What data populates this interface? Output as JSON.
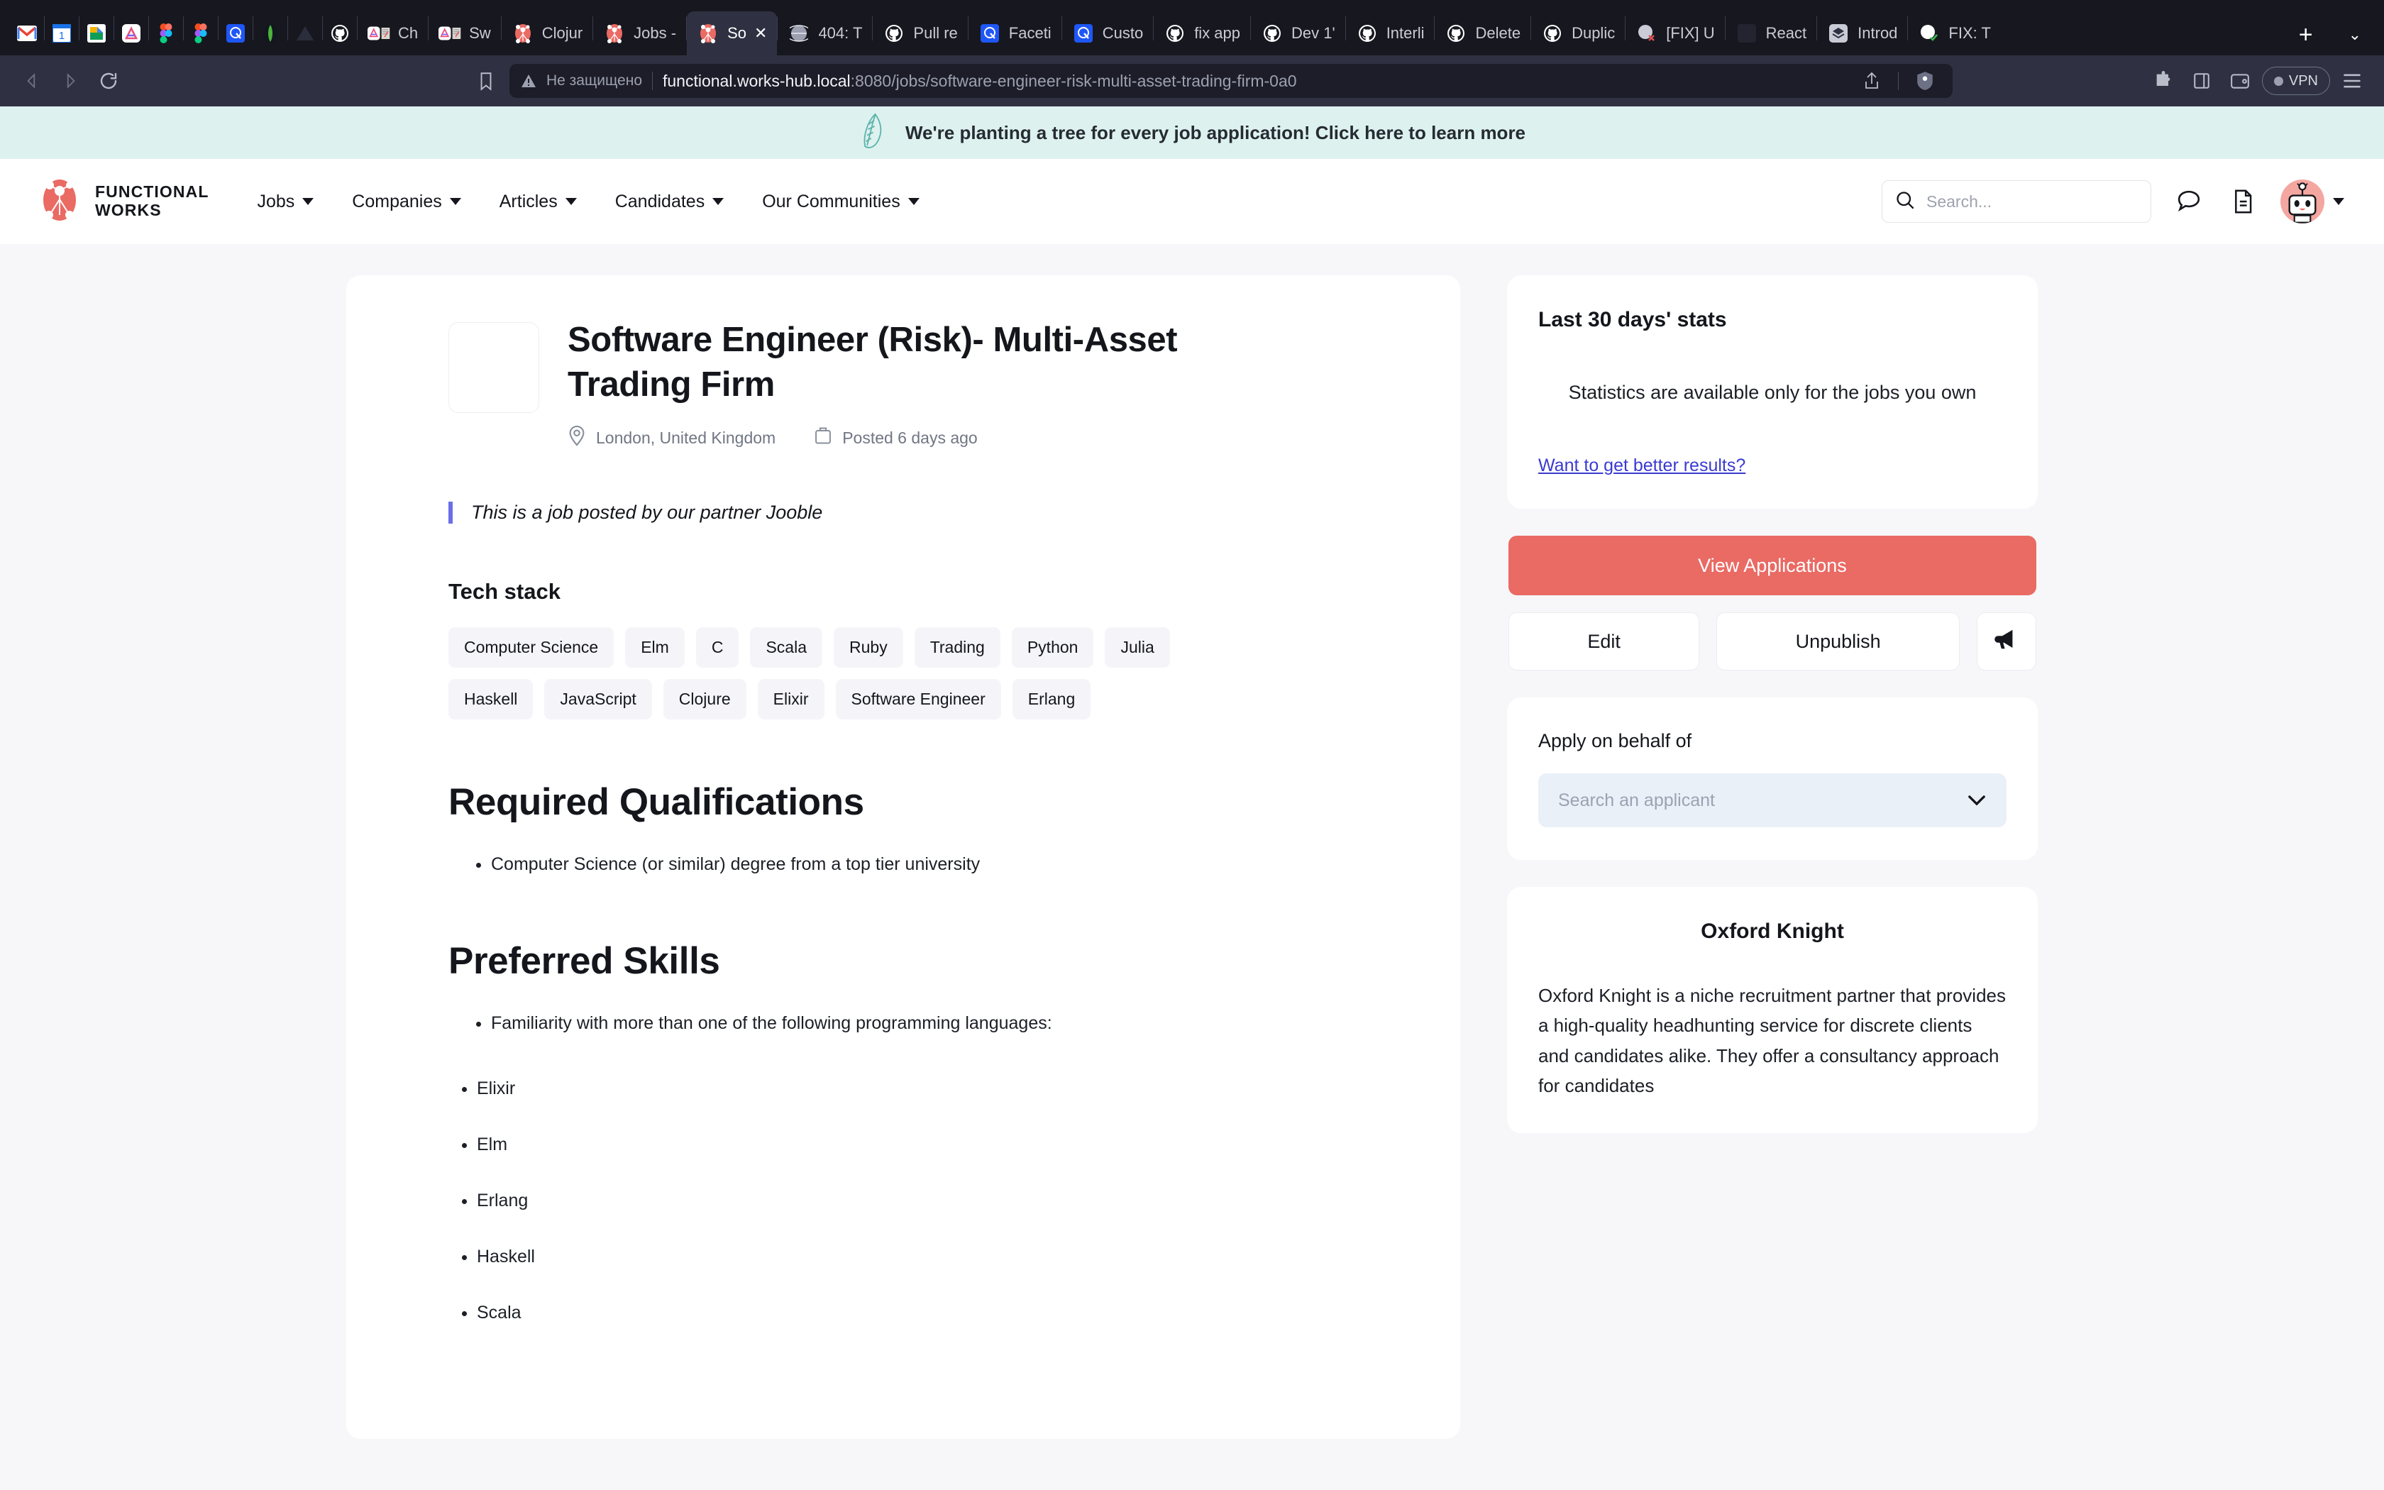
{
  "browser": {
    "tabs": [
      {
        "label": "",
        "icon": "gmail",
        "narrow": true
      },
      {
        "label": "",
        "icon": "gcal",
        "narrow": true
      },
      {
        "label": "",
        "icon": "gdrive",
        "narrow": true
      },
      {
        "label": "",
        "icon": "works",
        "narrow": true
      },
      {
        "label": "",
        "icon": "figma",
        "narrow": true
      },
      {
        "label": "",
        "icon": "figma",
        "narrow": true
      },
      {
        "label": "",
        "icon": "quip",
        "narrow": true
      },
      {
        "label": "",
        "icon": "mongo",
        "narrow": true
      },
      {
        "label": "",
        "icon": "vercel",
        "narrow": true
      },
      {
        "label": "",
        "icon": "github",
        "narrow": true
      },
      {
        "label": "Ch",
        "icon": "works-doc",
        "narrow": false
      },
      {
        "label": "Sw",
        "icon": "works-doc",
        "narrow": false
      },
      {
        "label": "Clojur",
        "icon": "fw",
        "narrow": false
      },
      {
        "label": "Jobs -",
        "icon": "fw",
        "narrow": false
      },
      {
        "label": "So",
        "icon": "fw",
        "narrow": false,
        "active": true,
        "closable": true
      },
      {
        "label": "404: T",
        "icon": "globe",
        "narrow": false
      },
      {
        "label": "Pull re",
        "icon": "github",
        "narrow": false
      },
      {
        "label": "Faceti",
        "icon": "quip",
        "narrow": false
      },
      {
        "label": "Custo",
        "icon": "quip",
        "narrow": false
      },
      {
        "label": "fix app",
        "icon": "github",
        "narrow": false
      },
      {
        "label": "Dev 1'",
        "icon": "github",
        "narrow": false
      },
      {
        "label": "Interli",
        "icon": "github",
        "narrow": false
      },
      {
        "label": "Delete",
        "icon": "github",
        "narrow": false
      },
      {
        "label": "Duplic",
        "icon": "github",
        "narrow": false
      },
      {
        "label": "[FIX] U",
        "icon": "github-x",
        "narrow": false
      },
      {
        "label": "React",
        "icon": "dim",
        "narrow": false
      },
      {
        "label": "Introd",
        "icon": "layers",
        "narrow": false
      },
      {
        "label": "FIX: T",
        "icon": "github-check",
        "narrow": false
      }
    ],
    "new_tab_label": "+",
    "tab_list_label": "⌄",
    "back_label": "◁",
    "forward_label": "▷",
    "reload_label": "↻",
    "bookmark_label": "ὑ6",
    "insecure_label": "Не защищено",
    "url_host": "functional.works-hub.local",
    "url_rest": ":8080/jobs/software-engineer-risk-multi-asset-trading-firm-0a0",
    "vpn_label": "VPN",
    "share_label": "share-icon",
    "brave_label": "brave-icon",
    "extensions_label": "extensions-icon",
    "sidepanel_label": "sidepanel-icon",
    "wallet_label": "wallet-icon",
    "menu_label": "menu-icon"
  },
  "eco_banner": {
    "text": "We're planting a tree for every job application! Click here to learn more",
    "icon": "leaf-icon"
  },
  "header": {
    "brand_line1": "FUNCTIONAL",
    "brand_line2": "WORKS",
    "nav": [
      {
        "label": "Jobs"
      },
      {
        "label": "Companies"
      },
      {
        "label": "Articles"
      },
      {
        "label": "Candidates"
      },
      {
        "label": "Our Communities"
      }
    ],
    "search_placeholder": "Search...",
    "chat_icon": "chat-bubble-icon",
    "doc_icon": "document-icon",
    "avatar_icon": "robot-avatar-icon"
  },
  "job": {
    "title": "Software Engineer (Risk)- Multi-Asset Trading Firm",
    "location": "London, United Kingdom",
    "posted": "Posted 6 days ago",
    "partner_note": "This is a job posted by our partner Jooble",
    "tech_stack_label": "Tech stack",
    "tech_stack": [
      "Computer Science",
      "Elm",
      "C",
      "Scala",
      "Ruby",
      "Trading",
      "Python",
      "Julia",
      "Haskell",
      "JavaScript",
      "Clojure",
      "Elixir",
      "Software Engineer",
      "Erlang"
    ],
    "sections": [
      {
        "heading": "Required Qualifications",
        "bullets": [
          "Computer Science (or similar) degree from a top tier university"
        ]
      },
      {
        "heading": "Preferred Skills",
        "bullets": [
          "Familiarity with more than one of the following programming languages:"
        ],
        "languages": [
          "Elixir",
          "Elm",
          "Erlang",
          "Haskell",
          "Scala"
        ]
      }
    ]
  },
  "sidebar": {
    "stats": {
      "title": "Last 30 days' stats",
      "message": "Statistics are available only for the jobs you own",
      "link": "Want to get better results?"
    },
    "actions": {
      "view_applications": "View Applications",
      "edit": "Edit",
      "unpublish": "Unpublish",
      "promote_icon": "megaphone-icon"
    },
    "apply": {
      "label": "Apply on behalf of",
      "placeholder": "Search an applicant",
      "caret": "⌄"
    },
    "company": {
      "name": "Oxford Knight",
      "description": "Oxford Knight is a niche recruitment partner that provides a high-quality headhunting service for discrete clients and candidates alike. They offer a consultancy approach for candidates"
    }
  },
  "colors": {
    "accent": "#ea6a64",
    "banner_bg": "#ddf2ef",
    "link": "#3a3ad0",
    "page_bg": "#f7f7fa"
  }
}
